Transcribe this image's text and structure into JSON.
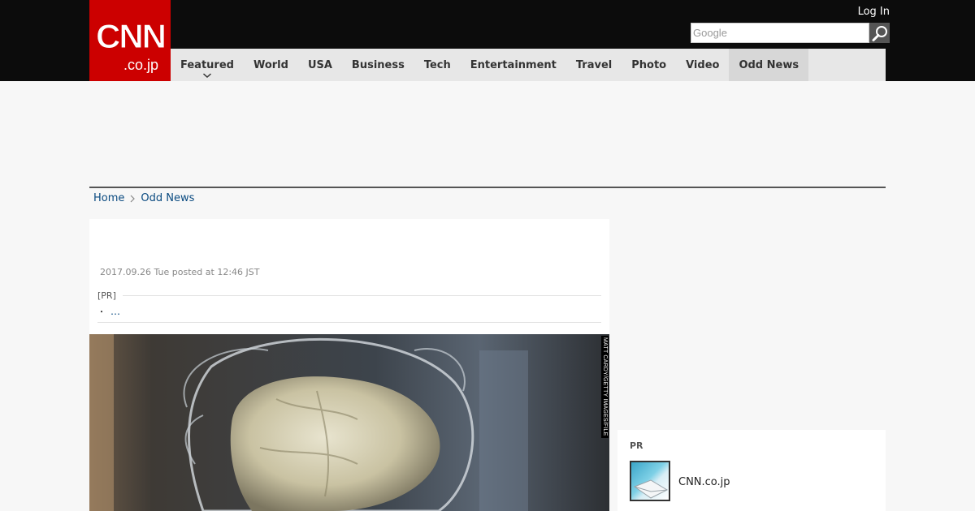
{
  "header": {
    "logo": {
      "main": "CNN",
      "sub": ".co.jp"
    },
    "login_label": "Log In",
    "search": {
      "placeholder": "Google",
      "value": ""
    }
  },
  "nav": {
    "items": [
      {
        "label": "Featured",
        "has_dropdown": true,
        "active": false
      },
      {
        "label": "World",
        "active": false
      },
      {
        "label": "USA",
        "active": false
      },
      {
        "label": "Business",
        "active": false
      },
      {
        "label": "Tech",
        "active": false
      },
      {
        "label": "Entertainment",
        "active": false
      },
      {
        "label": "Travel",
        "active": false
      },
      {
        "label": "Photo",
        "active": false
      },
      {
        "label": "Video",
        "active": false
      },
      {
        "label": "Odd News",
        "active": true
      }
    ]
  },
  "breadcrumb": {
    "home": "Home",
    "current": "Odd News"
  },
  "article": {
    "posted": "2017.09.26 Tue posted at 12:46 JST",
    "pr_label": "[PR]",
    "pr_bullet": "・",
    "pr_link": "…",
    "image": {
      "credit": "MATT CARDY/GETTY IMAGES/FILE"
    }
  },
  "sidebar": {
    "pr_label": "PR",
    "pr_item_title": "CNN.co.jp"
  },
  "colors": {
    "brand_red": "#cc0000",
    "header_bg": "#0c0c0c",
    "nav_bg": "#e7e7e7",
    "link_blue": "#0a4a80"
  },
  "icons": {
    "search": "magnifier-icon",
    "dropdown": "chevron-down-icon",
    "breadcrumb_sep": "chevron-right-icon"
  }
}
